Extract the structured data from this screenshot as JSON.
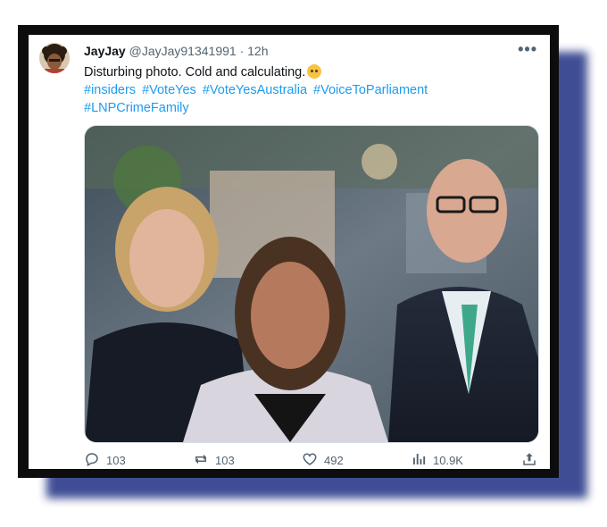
{
  "tweet": {
    "display_name": "JayJay",
    "handle": "@JayJay91341991",
    "separator": "·",
    "age": "12h",
    "more_icon": "more-horizontal-icon",
    "text": "Disturbing photo. Cold and calculating.",
    "emoji": "face-holding-back-tears-emoji",
    "hashtags": [
      "#insiders",
      "#VoteYes",
      "#VoteYesAustralia",
      "#VoiceToParliament",
      "#LNPCrimeFamily"
    ],
    "link_color": "#1d9bf0"
  },
  "metrics": {
    "replies": "103",
    "reposts": "103",
    "likes": "492",
    "views": "10.9K"
  },
  "icons": {
    "reply": "reply-icon",
    "repost": "repost-icon",
    "like": "heart-icon",
    "views": "views-chart-icon",
    "share": "share-icon"
  },
  "colors": {
    "frame": "#0d0d0d",
    "shadow": "#2f3f8c"
  }
}
